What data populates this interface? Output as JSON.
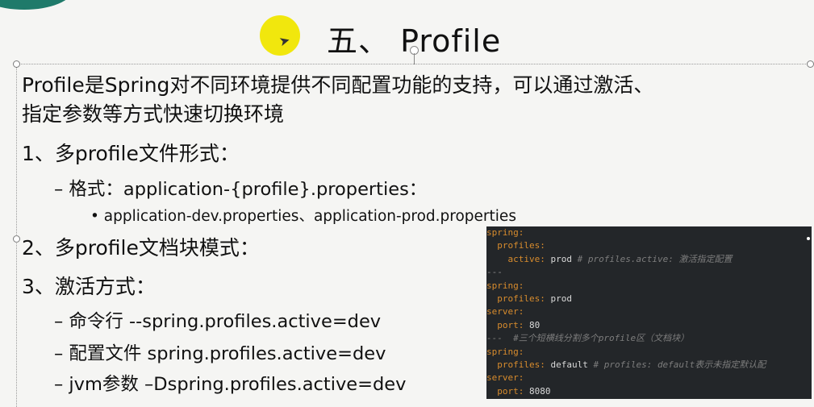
{
  "slide": {
    "title": "五、 Profile",
    "intro_line1": "Profile是Spring对不同环境提供不同配置功能的支持，可以通过激活、",
    "intro_line2": "指定参数等方式快速切换环境",
    "item1": "1、多profile文件形式：",
    "item1_sub": "– 格式：application-{profile}.properties：",
    "item1_subsub": "• application-dev.properties、application-prod.properties",
    "item2": "2、多profile文档块模式：",
    "item3": "3、激活方式：",
    "item3_subs": [
      "– 命令行  --spring.profiles.active=dev",
      "– 配置文件 spring.profiles.active=dev",
      "– jvm参数 –Dspring.profiles.active=dev"
    ]
  },
  "code": {
    "lines": [
      {
        "k": "spring:",
        "v": "",
        "c": ""
      },
      {
        "k": "  profiles:",
        "v": "",
        "c": ""
      },
      {
        "k": "    active:",
        "v": " prod ",
        "c": "# profiles.active: 激活指定配置"
      },
      {
        "k": "",
        "v": "",
        "c": "---",
        "sep": true
      },
      {
        "k": "spring:",
        "v": "",
        "c": ""
      },
      {
        "k": "  profiles:",
        "v": " prod",
        "c": ""
      },
      {
        "k": "server:",
        "v": "",
        "c": ""
      },
      {
        "k": "  port:",
        "v": " 80",
        "c": ""
      },
      {
        "k": "",
        "v": "",
        "c": "---  #三个短横线分割多个profile区（文档块）"
      },
      {
        "k": "spring:",
        "v": "",
        "c": ""
      },
      {
        "k": "  profiles:",
        "v": " default ",
        "c": "# profiles: default表示未指定默认配"
      },
      {
        "k": "server:",
        "v": "",
        "c": ""
      },
      {
        "k": "  port:",
        "v": " 8080",
        "c": ""
      }
    ]
  },
  "colors": {
    "code_bg": "#232629",
    "code_key": "#d88c2d",
    "code_value": "#d9d9d9",
    "code_comment": "#7d7d7d",
    "highlight": "#f0e600"
  }
}
